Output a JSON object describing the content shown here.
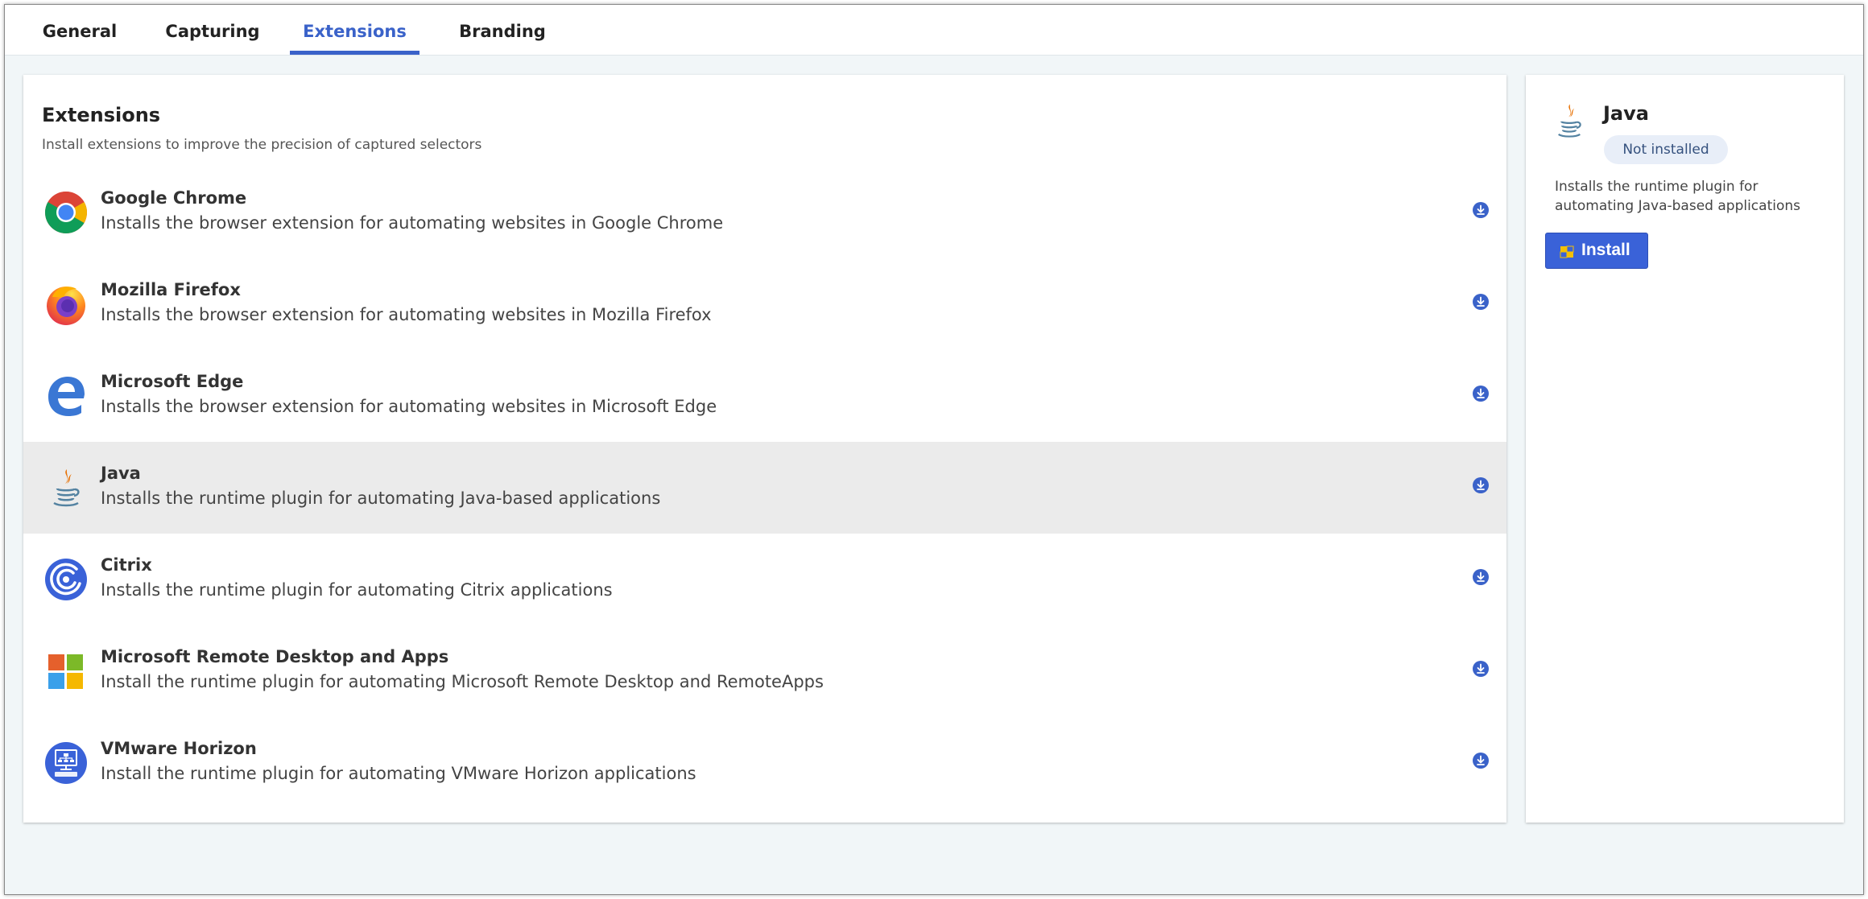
{
  "tabs": [
    {
      "label": "General"
    },
    {
      "label": "Capturing"
    },
    {
      "label": "Extensions",
      "active": true
    },
    {
      "label": "Branding"
    }
  ],
  "colors": {
    "accent": "#3a62c9",
    "selected_row": "#ebebeb",
    "background": "#f1f6f8",
    "badge_bg": "#e8eef8",
    "button": "#3a62d8"
  },
  "extensions_panel": {
    "title": "Extensions",
    "subtitle": "Install extensions to improve the precision of captured selectors",
    "items": [
      {
        "name": "Google Chrome",
        "description": "Installs the browser extension for automating websites in Google Chrome",
        "icon": "chrome-icon"
      },
      {
        "name": "Mozilla Firefox",
        "description": "Installs the browser extension for automating websites in Mozilla Firefox",
        "icon": "firefox-icon"
      },
      {
        "name": "Microsoft Edge",
        "description": "Installs the browser extension for automating websites in Microsoft Edge",
        "icon": "edge-icon"
      },
      {
        "name": "Java",
        "description": "Installs the runtime plugin for automating Java-based applications",
        "icon": "java-icon",
        "selected": true
      },
      {
        "name": "Citrix",
        "description": "Installs the runtime plugin for automating Citrix applications",
        "icon": "citrix-icon"
      },
      {
        "name": "Microsoft Remote Desktop and Apps",
        "description": "Install the runtime plugin for automating Microsoft Remote Desktop and RemoteApps",
        "icon": "microsoft-icon"
      },
      {
        "name": "VMware Horizon",
        "description": "Install the runtime plugin for automating VMware Horizon applications",
        "icon": "vmware-icon"
      }
    ]
  },
  "detail_panel": {
    "title": "Java",
    "status": "Not installed",
    "description": "Installs the runtime plugin for automating Java-based applications",
    "install_label": "Install",
    "icon": "java-icon",
    "button_icon": "shield-icon"
  }
}
